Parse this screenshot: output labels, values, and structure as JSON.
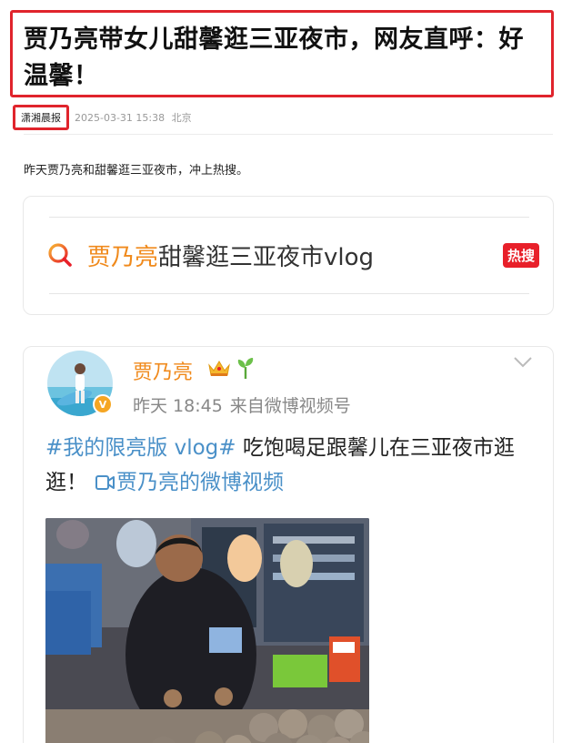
{
  "article": {
    "headline": "贾乃亮带女儿甜馨逛三亚夜市，网友直呼：好温馨！",
    "source": "潇湘晨报",
    "datetime": "2025-03-31 15:38",
    "location": "北京",
    "intro": "昨天贾乃亮和甜馨逛三亚夜市，冲上热搜。"
  },
  "hot_search": {
    "name": "贾乃亮",
    "title_rest": "甜馨逛三亚夜市vlog",
    "badge": "热搜",
    "icon": "search-icon"
  },
  "post": {
    "username": "贾乃亮",
    "verify_mark": "V",
    "time": "昨天 18:45",
    "via": "来自微博视频号",
    "topic": "#我的限亮版 vlog#",
    "text": " 吃饱喝足跟馨儿在三亚夜市逛逛！",
    "video_link": "贾乃亮的微博视频",
    "icons": [
      "crown-icon",
      "sprout-icon",
      "chevron-down-icon",
      "video-icon"
    ]
  },
  "colors": {
    "accent_red": "#e0242c",
    "name_orange": "#f08a1c",
    "link_blue": "#4a90c8",
    "badge_red": "#e8202a"
  }
}
